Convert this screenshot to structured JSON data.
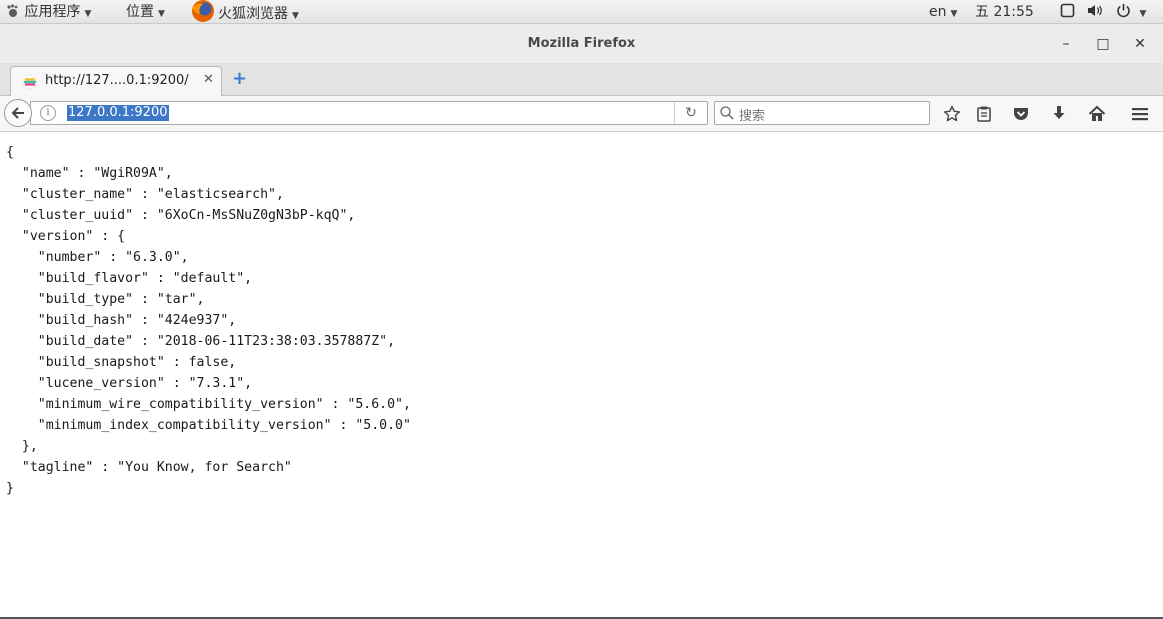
{
  "panel": {
    "applications": "应用程序",
    "places": "位置",
    "browser": "火狐浏览器",
    "lang": "en",
    "clock": "五 21:55"
  },
  "window": {
    "title": "Mozilla Firefox",
    "minimize": "–",
    "maximize": "□",
    "close": "✕"
  },
  "tab": {
    "title": "http://127....0.1:9200/",
    "close": "✕",
    "new_tab": "+"
  },
  "navbar": {
    "url": "127.0.0.1:9200",
    "search_placeholder": "搜索"
  },
  "icons": {
    "back": "back-arrow-icon",
    "info": "info-icon",
    "reload": "reload-icon",
    "search": "search-icon",
    "bookmark": "star-icon",
    "reader": "clipboard-icon",
    "pocket": "pocket-icon",
    "downloads": "download-icon",
    "home": "home-icon",
    "menu": "hamburger-icon"
  },
  "colors": {
    "url_highlight": "#3d77c8",
    "new_tab_plus": "#3a7bd5"
  },
  "response_json": "{\n  \"name\" : \"WgiR09A\",\n  \"cluster_name\" : \"elasticsearch\",\n  \"cluster_uuid\" : \"6XoCn-MsSNuZ0gN3bP-kqQ\",\n  \"version\" : {\n    \"number\" : \"6.3.0\",\n    \"build_flavor\" : \"default\",\n    \"build_type\" : \"tar\",\n    \"build_hash\" : \"424e937\",\n    \"build_date\" : \"2018-06-11T23:38:03.357887Z\",\n    \"build_snapshot\" : false,\n    \"lucene_version\" : \"7.3.1\",\n    \"minimum_wire_compatibility_version\" : \"5.6.0\",\n    \"minimum_index_compatibility_version\" : \"5.0.0\"\n  },\n  \"tagline\" : \"You Know, for Search\"\n}"
}
